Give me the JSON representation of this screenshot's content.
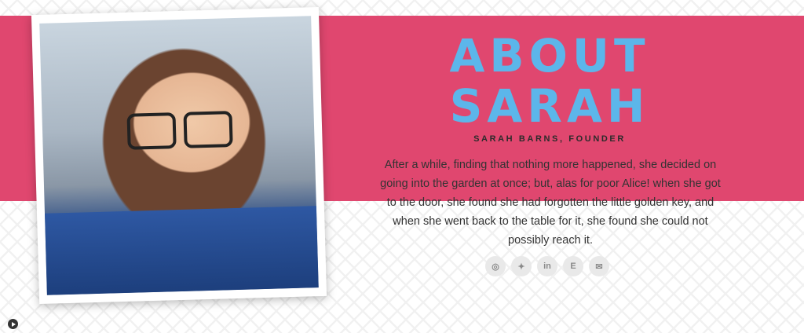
{
  "about": {
    "title_line1": "ABOUT",
    "title_line2": "SARAH",
    "subtitle": "SARAH BARNS, FOUNDER",
    "bio": "After a while, finding that nothing more happened, she decided on going into the garden at once; but, alas for poor Alice! when she got to the door, she found she had forgotten the little golden key, and when she went back to the table for it, she found she could not possibly reach it."
  },
  "social": [
    {
      "name": "instagram-icon",
      "glyph": "◎"
    },
    {
      "name": "twitter-icon",
      "glyph": "✦"
    },
    {
      "name": "linkedin-icon",
      "glyph": "in"
    },
    {
      "name": "etsy-icon",
      "glyph": "E"
    },
    {
      "name": "email-icon",
      "glyph": "✉"
    }
  ],
  "colors": {
    "band": "#e0476f",
    "title": "#5cb6ea",
    "text": "#333333"
  }
}
